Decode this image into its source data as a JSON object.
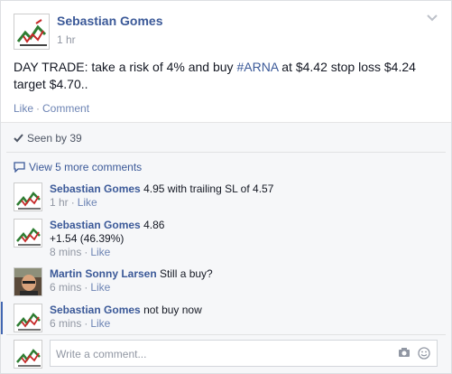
{
  "post": {
    "author": "Sebastian Gomes",
    "time": "1 hr",
    "text_prefix": "DAY TRADE: take a risk of 4% and buy ",
    "hashtag": "#ARNA",
    "text_suffix": " at $4.42 stop loss $4.24 target $4.70..",
    "like_label": "Like",
    "comment_label": "Comment",
    "separator": "·"
  },
  "seen": {
    "label": "Seen by 39"
  },
  "more_comments": {
    "label": "View 5 more comments"
  },
  "comments": [
    {
      "author": "Sebastian Gomes",
      "text": "4.95 with trailing SL of 4.57",
      "text2": "",
      "time": "1 hr",
      "like": "Like"
    },
    {
      "author": "Sebastian Gomes",
      "text": "4.86",
      "text2": "+1.54 (46.39%)",
      "time": "8 mins",
      "like": "Like"
    },
    {
      "author": "Martin Sonny Larsen",
      "text": "Still a buy?",
      "text2": "",
      "time": "6 mins",
      "like": "Like"
    },
    {
      "author": "Sebastian Gomes",
      "text": "not buy now",
      "text2": "",
      "time": "6 mins",
      "like": "Like"
    }
  ],
  "composer": {
    "placeholder": "Write a comment..."
  },
  "colors": {
    "link": "#3b5998",
    "meta": "#9197a3",
    "ufi_bg": "#f6f7f9"
  }
}
